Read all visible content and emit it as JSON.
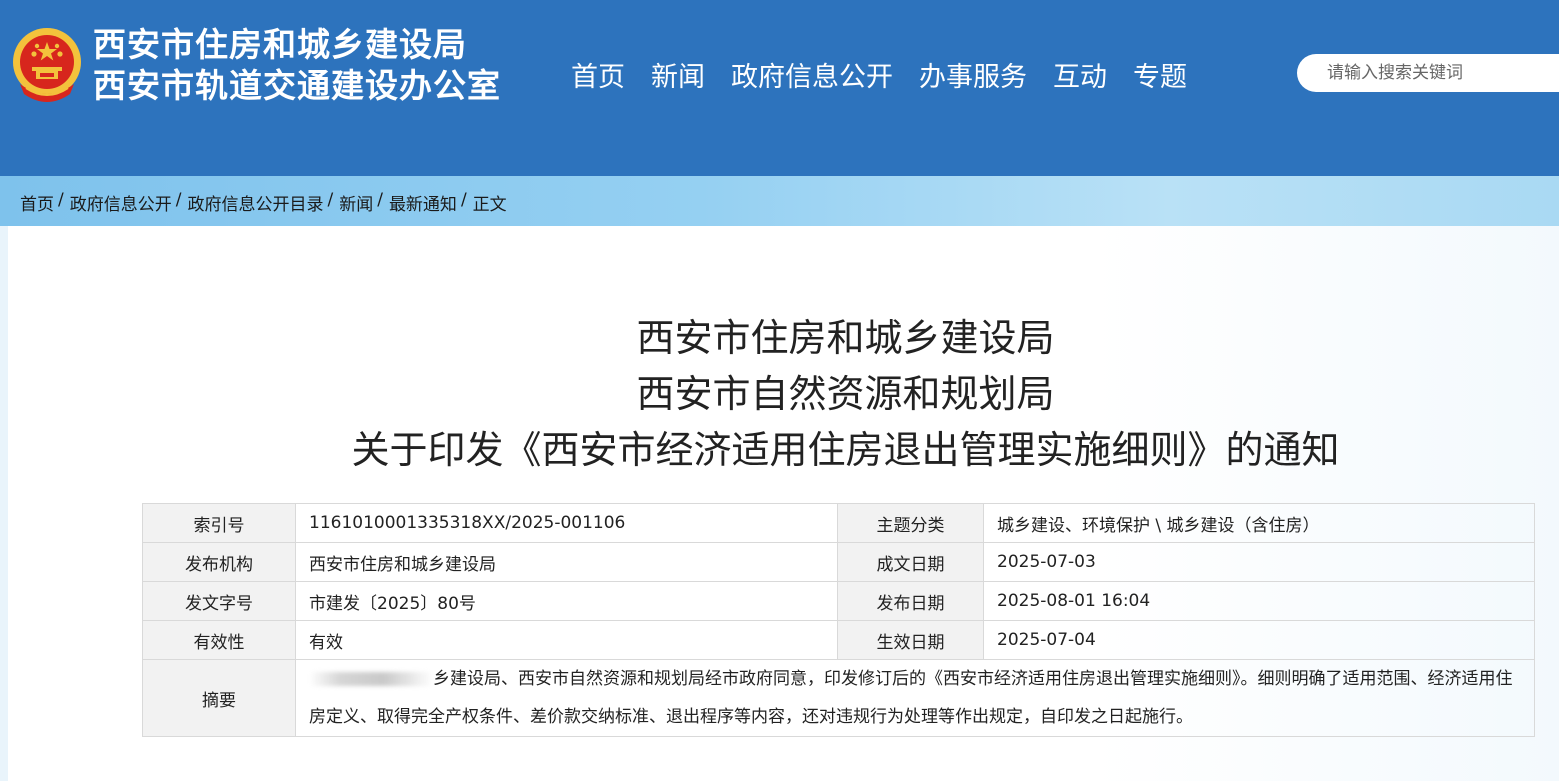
{
  "header": {
    "site_name_line1": "西安市住房和城乡建设局",
    "site_name_line2": "西安市轨道交通建设办公室",
    "emblem_icon": "national-emblem-icon",
    "colors": {
      "header_bg": "#2d73bd",
      "emblem_red": "#d7261d",
      "emblem_gold": "#f3c23c"
    }
  },
  "nav": {
    "items": [
      "首页",
      "新闻",
      "政府信息公开",
      "办事服务",
      "互动",
      "专题"
    ]
  },
  "search": {
    "placeholder": "请输入搜索关键词"
  },
  "breadcrumb": {
    "items": [
      "首页",
      "政府信息公开",
      "政府信息公开目录",
      "新闻",
      "最新通知",
      "正文"
    ],
    "separator": "/"
  },
  "article": {
    "title_line1": "西安市住房和城乡建设局",
    "title_line2": "西安市自然资源和规划局",
    "title_line3": "关于印发《西安市经济适用住房退出管理实施细则》的通知"
  },
  "meta": {
    "index_no_label": "索引号",
    "index_no": "1161010001335318XX/2025-001106",
    "topic_label": "主题分类",
    "topic": "城乡建设、环境保护 \\ 城乡建设（含住房）",
    "issuer_label": "发布机构",
    "issuer": "西安市住房和城乡建设局",
    "written_date_label": "成文日期",
    "written_date": "2025-07-03",
    "doc_no_label": "发文字号",
    "doc_no": "市建发〔2025〕80号",
    "publish_date_label": "发布日期",
    "publish_date": "2025-08-01 16:04",
    "validity_label": "有效性",
    "validity": "有效",
    "effective_date_label": "生效日期",
    "effective_date": "2025-07-04",
    "summary_label": "摘要",
    "summary_visible": "乡建设局、西安市自然资源和规划局经市政府同意，印发修订后的《西安市经济适用住房退出管理实施细则》。细则明确了适用范围、经济适用住房定义、取得完全产权条件、差价款交纳标准、退出程序等内容，还对违规行为处理等作出规定，自印发之日起施行。"
  }
}
